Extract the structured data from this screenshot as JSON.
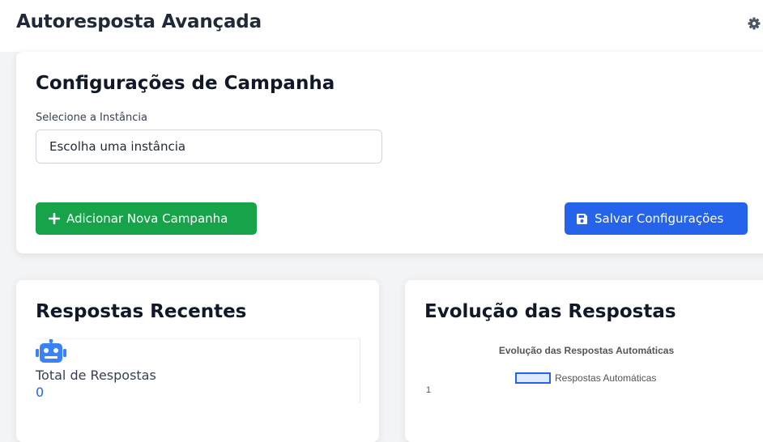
{
  "header": {
    "title": "Autoresposta Avançada",
    "settings_icon": "gear-icon"
  },
  "campaign": {
    "title": "Configurações de Campanha",
    "instance_label": "Selecione a Instância",
    "instance_value": "Escolha uma instância",
    "add_button": "Adicionar Nova Campanha",
    "add_icon": "plus-icon",
    "save_button": "Salvar Configurações",
    "save_icon": "floppy-disk-icon",
    "add_color": "#16a34a",
    "save_color": "#2563eb"
  },
  "recent": {
    "title": "Respostas Recentes",
    "icon": "robot-icon",
    "total_label": "Total de Respostas",
    "total_value": "0"
  },
  "evolution": {
    "title": "Evolução das Respostas"
  },
  "chart_data": {
    "type": "line",
    "title": "Evolução das Respostas Automáticas",
    "series": [
      {
        "name": "Respostas Automáticas",
        "values": []
      }
    ],
    "y_ticks": [
      "1"
    ],
    "series_color": "#2563eb"
  }
}
